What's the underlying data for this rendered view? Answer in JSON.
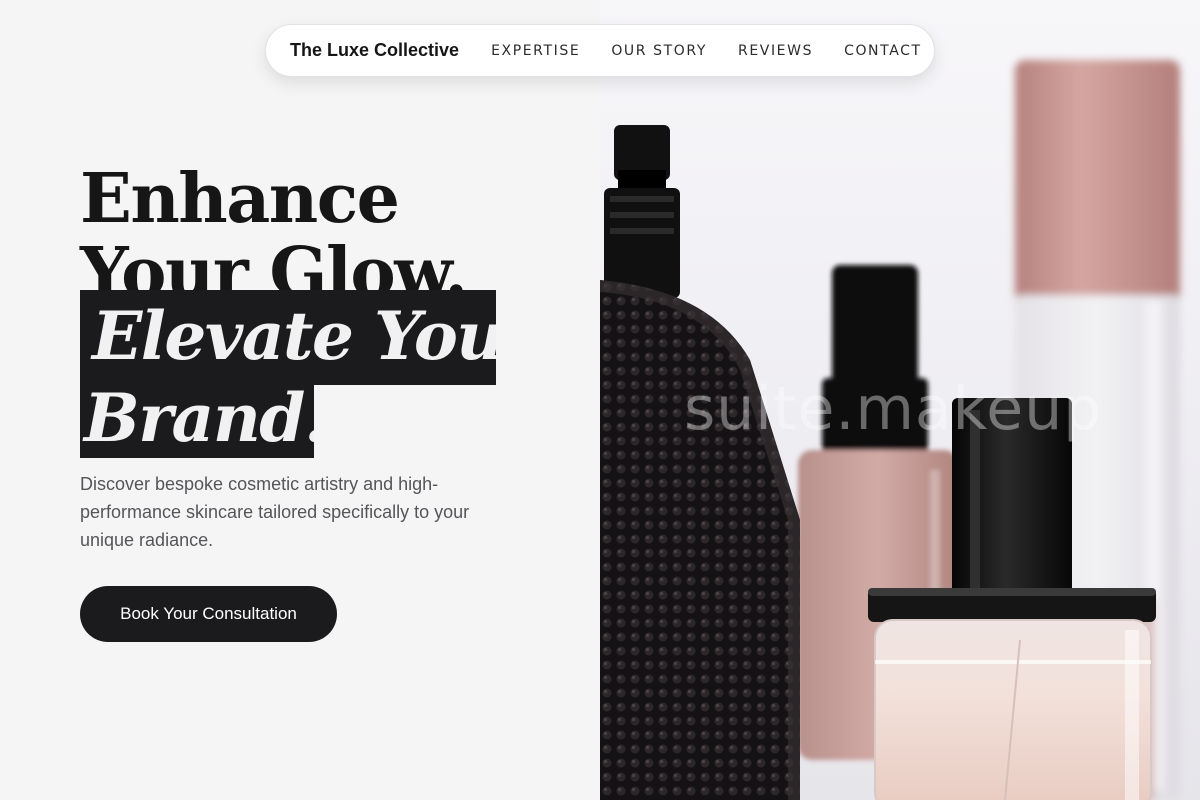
{
  "nav": {
    "brand": "The Luxe Collective",
    "links": [
      "EXPERTISE",
      "OUR STORY",
      "REVIEWS",
      "CONTACT"
    ]
  },
  "hero": {
    "headline_line1": "Enhance",
    "headline_line2": "Your Glow.",
    "highlight_line1": "Elevate Your",
    "highlight_line2": "Brand.",
    "description": "Discover bespoke cosmetic artistry and high-performance skincare tailored specifically to your unique radiance.",
    "cta_label": "Book Your Consultation"
  },
  "photo": {
    "watermark": "suite.makeup"
  },
  "colors": {
    "accent_dark": "#1b1b1d",
    "background": "#f5f5f5",
    "text_muted": "#55555a",
    "rose": "#c89a97"
  }
}
